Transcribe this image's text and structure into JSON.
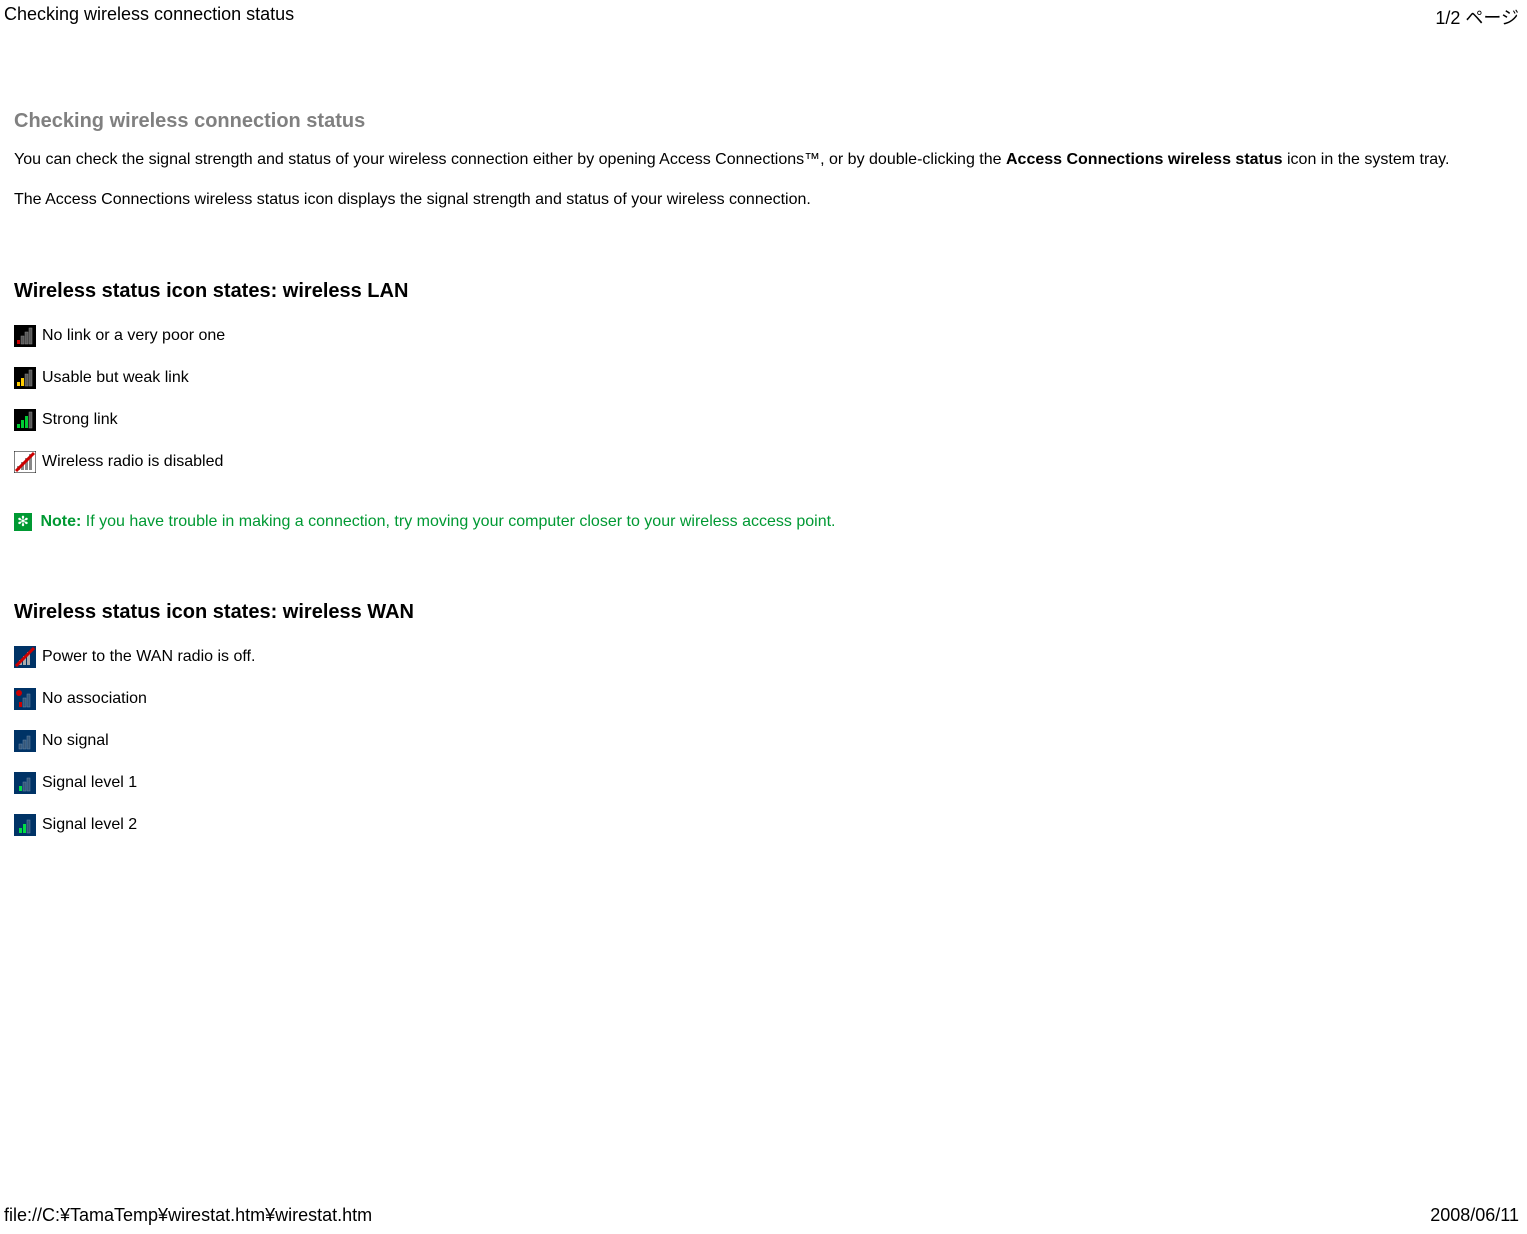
{
  "header": {
    "title": "Checking wireless connection status",
    "page_info": "1/2 ページ"
  },
  "page": {
    "title": "Checking wireless connection status",
    "intro_part1": "You can check the signal strength and status of your wireless connection either by opening Access Connections™, or by double-clicking the ",
    "intro_bold": "Access Connections wireless status",
    "intro_part2": " icon in the system tray.",
    "intro_line2": "The Access Connections wireless status icon displays the signal strength and status of your wireless connection."
  },
  "lan": {
    "title": "Wireless status icon states: wireless LAN",
    "items": [
      "No link or a very poor one",
      "Usable but weak link",
      "Strong link",
      "Wireless radio is disabled"
    ]
  },
  "note": {
    "label": "Note:",
    "text": " If you have trouble in making a connection, try moving your computer closer to your wireless access point."
  },
  "wan": {
    "title": "Wireless status icon states: wireless WAN",
    "items": [
      "Power to the WAN radio is off.",
      "No association",
      "No signal",
      "Signal level 1",
      "Signal level 2"
    ]
  },
  "footer": {
    "path": "file://C:¥TamaTemp¥wirestat.htm¥wirestat.htm",
    "date": "2008/06/11"
  }
}
